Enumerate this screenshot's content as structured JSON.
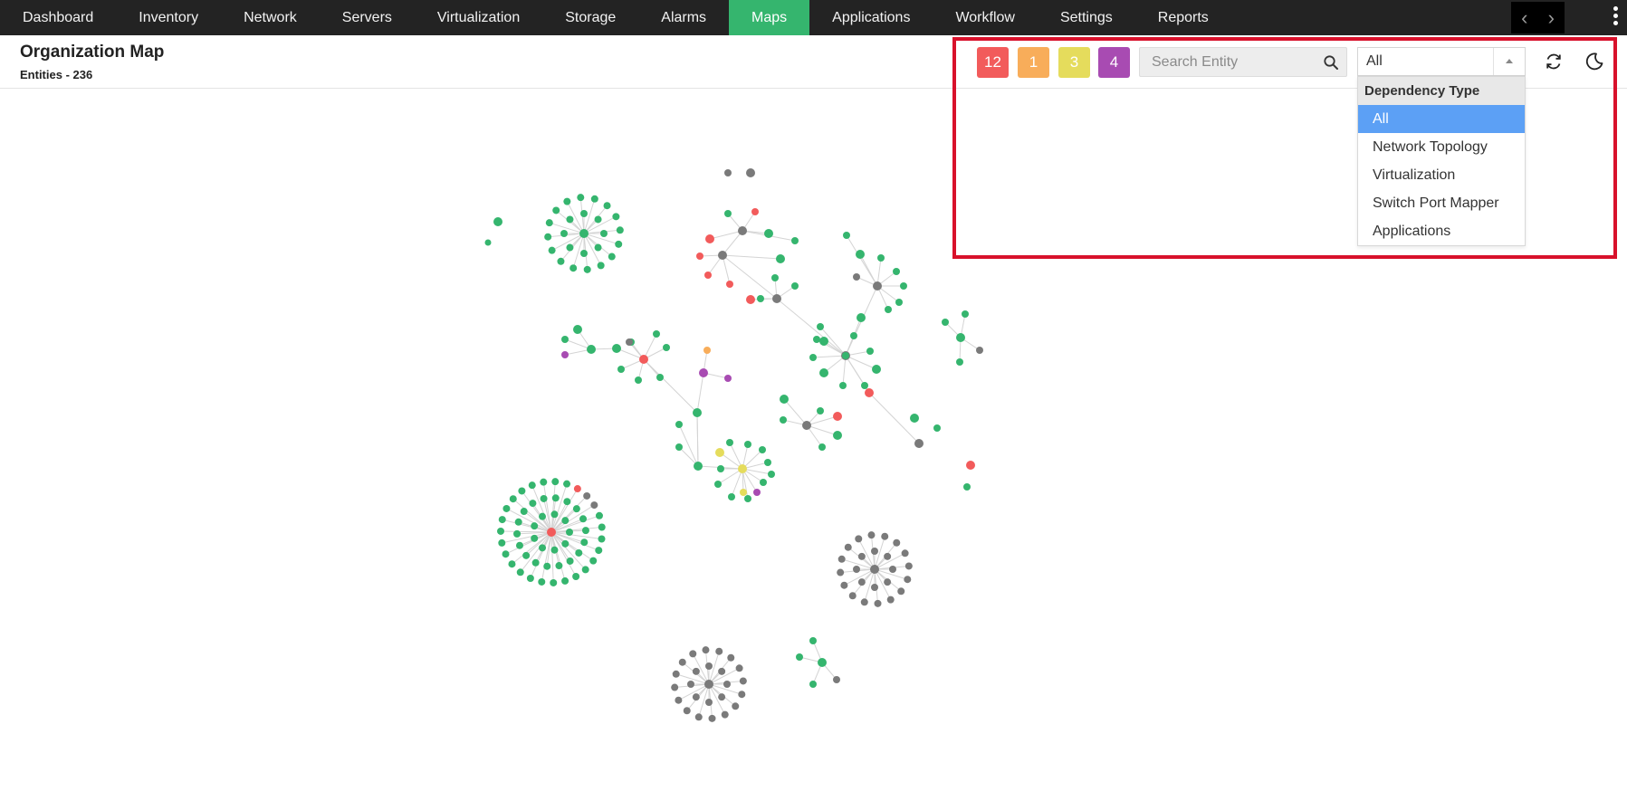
{
  "nav": {
    "items": [
      {
        "label": "Dashboard",
        "active": false
      },
      {
        "label": "Inventory",
        "active": false
      },
      {
        "label": "Network",
        "active": false
      },
      {
        "label": "Servers",
        "active": false
      },
      {
        "label": "Virtualization",
        "active": false
      },
      {
        "label": "Storage",
        "active": false
      },
      {
        "label": "Alarms",
        "active": false
      },
      {
        "label": "Maps",
        "active": true
      },
      {
        "label": "Applications",
        "active": false
      },
      {
        "label": "Workflow",
        "active": false
      },
      {
        "label": "Settings",
        "active": false
      },
      {
        "label": "Reports",
        "active": false
      }
    ],
    "prev_icon": "chevron-left-icon",
    "next_icon": "chevron-right-icon",
    "menu_icon": "kebab-menu-icon"
  },
  "header": {
    "title": "Organization Map",
    "entities": "Entities - 236"
  },
  "alarm_badges": [
    {
      "count": "12",
      "color": "#f25b5b",
      "severity": "critical"
    },
    {
      "count": "1",
      "color": "#f8ad5a",
      "severity": "trouble"
    },
    {
      "count": "3",
      "color": "#e5dc5c",
      "severity": "attention"
    },
    {
      "count": "4",
      "color": "#a84bb2",
      "severity": "service-down"
    }
  ],
  "search": {
    "placeholder": "Search Entity",
    "value": "",
    "icon": "search-icon"
  },
  "dependency_select": {
    "value": "All",
    "header": "Dependency Type",
    "options": [
      {
        "label": "All",
        "selected": true
      },
      {
        "label": "Network Topology",
        "selected": false
      },
      {
        "label": "Virtualization",
        "selected": false
      },
      {
        "label": "Switch Port Mapper",
        "selected": false
      },
      {
        "label": "Applications",
        "selected": false
      }
    ]
  },
  "toolbar": {
    "refresh_icon": "refresh-icon",
    "theme_icon": "moon-icon"
  },
  "colors": {
    "nav_bg": "#232323",
    "nav_active": "#35b56e",
    "highlight_border": "#d8112b",
    "node_up": "#35b56e",
    "node_unknown": "#7a7a7a",
    "node_critical": "#f25b5b",
    "node_trouble": "#f8ad5a",
    "node_attention": "#e5dc5c",
    "node_down": "#a84bb2",
    "dropdown_selected": "#5ca0f5"
  }
}
